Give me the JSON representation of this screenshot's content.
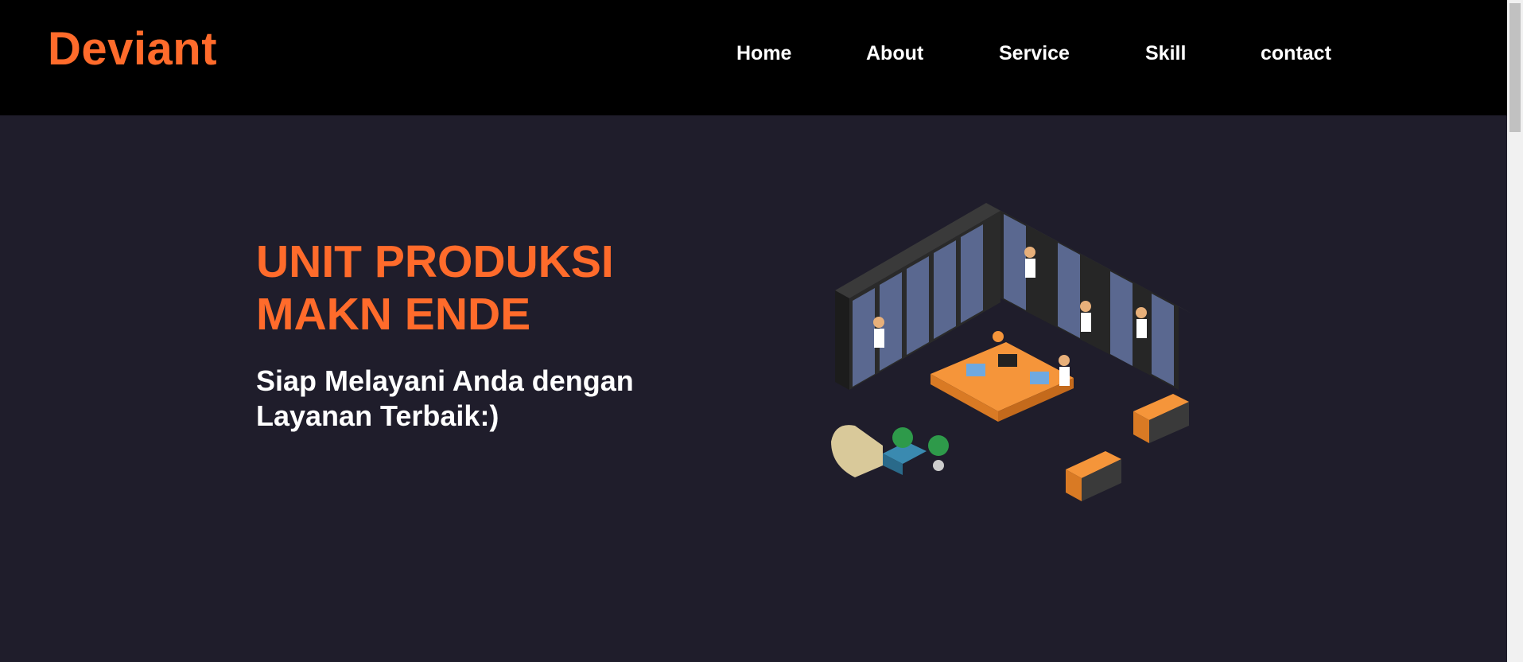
{
  "navbar": {
    "logo": "Deviant",
    "links": [
      {
        "label": "Home"
      },
      {
        "label": "About"
      },
      {
        "label": "Service"
      },
      {
        "label": "Skill"
      },
      {
        "label": "contact"
      }
    ]
  },
  "hero": {
    "title": "UNIT PRODUKSI MAKN ENDE",
    "subtitle": "Siap Melayani Anda dengan Layanan Terbaik:)",
    "illustration_icon": "server-room-illustration"
  },
  "colors": {
    "accent": "#ff6b2b",
    "background": "#1f1d2b",
    "navbar": "#000000",
    "text": "#ffffff"
  }
}
